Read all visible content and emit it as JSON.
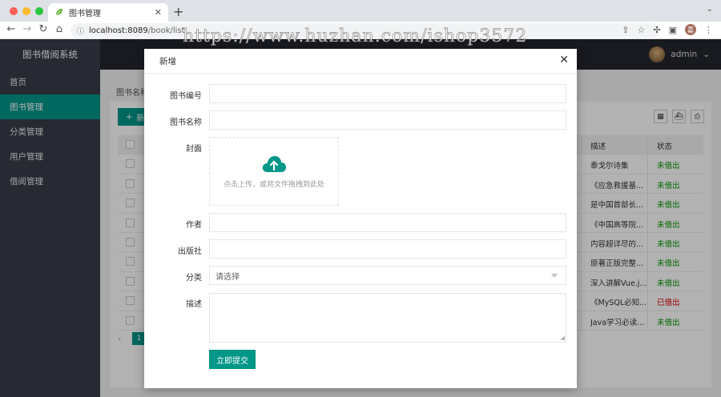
{
  "browser": {
    "tab_title": "图书管理",
    "url_host": "localhost:8089",
    "url_path": "/book/list",
    "profile_initial": "嘉",
    "watermark": "https://www.huzhan.com/ishop3572"
  },
  "app": {
    "system_name": "图书借阅系统",
    "menu": [
      {
        "label": "首页"
      },
      {
        "label": "图书管理"
      },
      {
        "label": "分类管理"
      },
      {
        "label": "用户管理"
      },
      {
        "label": "借阅管理"
      }
    ],
    "user_name": "admin"
  },
  "page": {
    "search_label": "图书名称",
    "add_button_label": "新",
    "table_headers": {
      "desc": "描述",
      "status": "状态"
    },
    "rows": [
      {
        "desc": "泰戈尔诗集",
        "status": "未借出"
      },
      {
        "desc": "《应急救援基...",
        "status": "未借出"
      },
      {
        "desc": "是中国首部长...",
        "status": "未借出"
      },
      {
        "desc": "《中国高等院...",
        "status": "未借出"
      },
      {
        "desc": "内容超详尽的...",
        "status": "未借出"
      },
      {
        "desc": "原著正版完整...",
        "status": "未借出"
      },
      {
        "desc": "深入讲解Vue.j...",
        "status": "未借出"
      },
      {
        "desc": "《MySQL必知...",
        "status": "已借出"
      },
      {
        "desc": "Java学习必读...",
        "status": "未借出"
      }
    ],
    "current_page": "1"
  },
  "modal": {
    "title": "新增",
    "fields": {
      "book_number": "图书编号",
      "book_name": "图书名称",
      "cover": "封面",
      "author": "作者",
      "publisher": "出版社",
      "category": "分类",
      "description": "描述"
    },
    "upload_text": "点击上传，或将文件拖拽到此处",
    "category_placeholder": "请选择",
    "submit_label": "立即提交"
  },
  "colors": {
    "accent": "#009688",
    "sidebar": "#393d49",
    "header": "#23262e",
    "status_available": "#009900",
    "status_borrowed": "#e00000"
  }
}
